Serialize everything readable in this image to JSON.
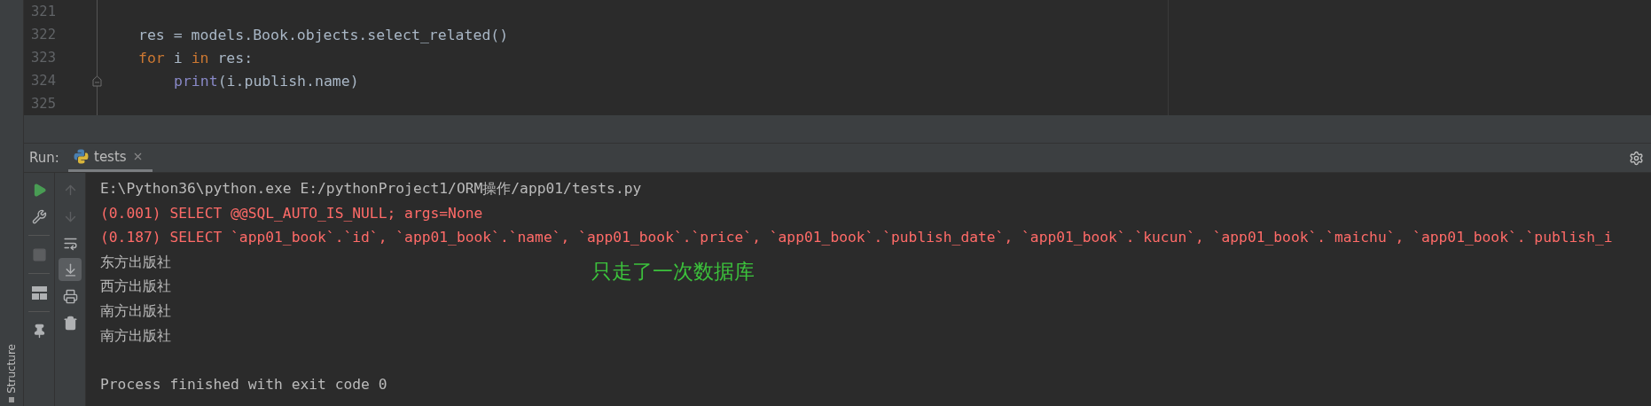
{
  "side_stripe": {
    "label": "Structure"
  },
  "editor": {
    "lines": [
      {
        "number": "321"
      },
      {
        "number": "322",
        "tokens": [
          {
            "text": "res = models.Book.objects.select_related()",
            "kind": "plain"
          }
        ]
      },
      {
        "number": "323",
        "tokens": [
          {
            "text": "for",
            "kind": "keyword"
          },
          {
            "text": " i ",
            "kind": "plain"
          },
          {
            "text": "in",
            "kind": "keyword"
          },
          {
            "text": " res:",
            "kind": "plain"
          }
        ],
        "children": [
          {
            "number": "324",
            "fold_marker": true,
            "tokens": [
              {
                "text": "print",
                "kind": "builtin"
              },
              {
                "text": "(i.publish.name)",
                "kind": "plain"
              }
            ]
          }
        ]
      },
      {
        "number": "325"
      }
    ]
  },
  "run_panel": {
    "label": "Run:",
    "tabs": [
      {
        "label": "tests",
        "selected": true
      }
    ],
    "tools": [
      {
        "kind": "run",
        "disabled": false
      },
      {
        "kind": "wrench",
        "disabled": false
      },
      {
        "kind": "stop",
        "disabled": true
      },
      {
        "kind": "layout",
        "disabled": false
      },
      {
        "kind": "pin",
        "disabled": false
      }
    ],
    "output_tools": [
      {
        "kind": "up",
        "disabled": true,
        "selected": false
      },
      {
        "kind": "down",
        "disabled": true,
        "selected": false
      },
      {
        "kind": "wrap",
        "disabled": false,
        "selected": false
      },
      {
        "kind": "scroll_end",
        "disabled": false,
        "selected": true
      },
      {
        "kind": "print",
        "disabled": false,
        "selected": false
      },
      {
        "kind": "trash",
        "disabled": false,
        "selected": false
      }
    ],
    "console": [
      {
        "kind": "command",
        "text": "E:\\Python36\\python.exe E:/pythonProject1/ORM操作/app01/tests.py"
      },
      {
        "kind": "sql",
        "text": "(0.001) SELECT @@SQL_AUTO_IS_NULL; args=None"
      },
      {
        "kind": "sql",
        "text": "(0.187) SELECT `app01_book`.`id`, `app01_book`.`name`, `app01_book`.`price`, `app01_book`.`publish_date`, `app01_book`.`kucun`, `app01_book`.`maichu`, `app01_book`.`publish_i"
      },
      {
        "kind": "output",
        "text": "东方出版社"
      },
      {
        "kind": "output",
        "text": "西方出版社"
      },
      {
        "kind": "output",
        "text": "南方出版社"
      },
      {
        "kind": "output",
        "text": "南方出版社"
      },
      {
        "kind": "status",
        "text": "Process finished with exit code 0"
      }
    ],
    "annotation": {
      "text": "只走了一次数据库"
    }
  }
}
